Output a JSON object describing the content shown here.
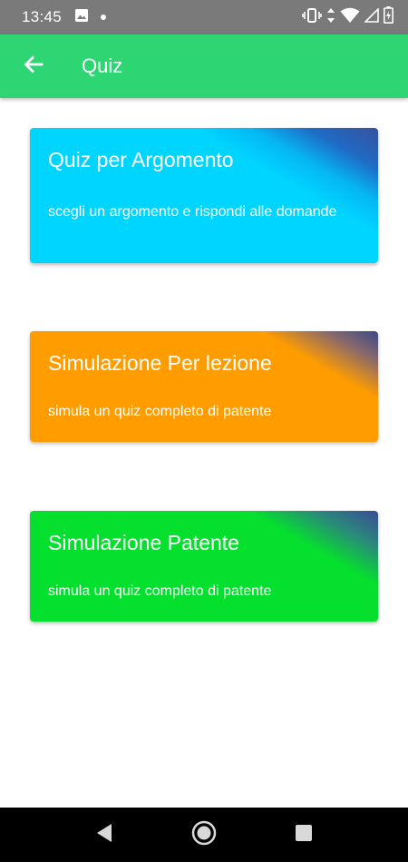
{
  "status_bar": {
    "time": "13:45",
    "left_icons": [
      "image-icon",
      "dot-icon"
    ],
    "right_icons": [
      "vibrate-icon",
      "data-arrows-icon",
      "wifi-icon",
      "signal-icon",
      "battery-icon"
    ]
  },
  "app_bar": {
    "title": "Quiz",
    "back_icon": "arrow-left-icon",
    "color": "#2ed573"
  },
  "cards": [
    {
      "title": "Quiz per Argomento",
      "description": "scegli un argomento e rispondi alle domande",
      "color": "#00d5ff"
    },
    {
      "title": "Simulazione Per lezione",
      "description": "simula un quiz completo di patente",
      "color": "#ff9d00"
    },
    {
      "title": "Simulazione Patente",
      "description": "simula un quiz completo di patente",
      "color": "#05df2e"
    }
  ],
  "nav_bar": {
    "buttons": [
      "back-triangle-icon",
      "home-circle-icon",
      "recents-square-icon"
    ]
  }
}
